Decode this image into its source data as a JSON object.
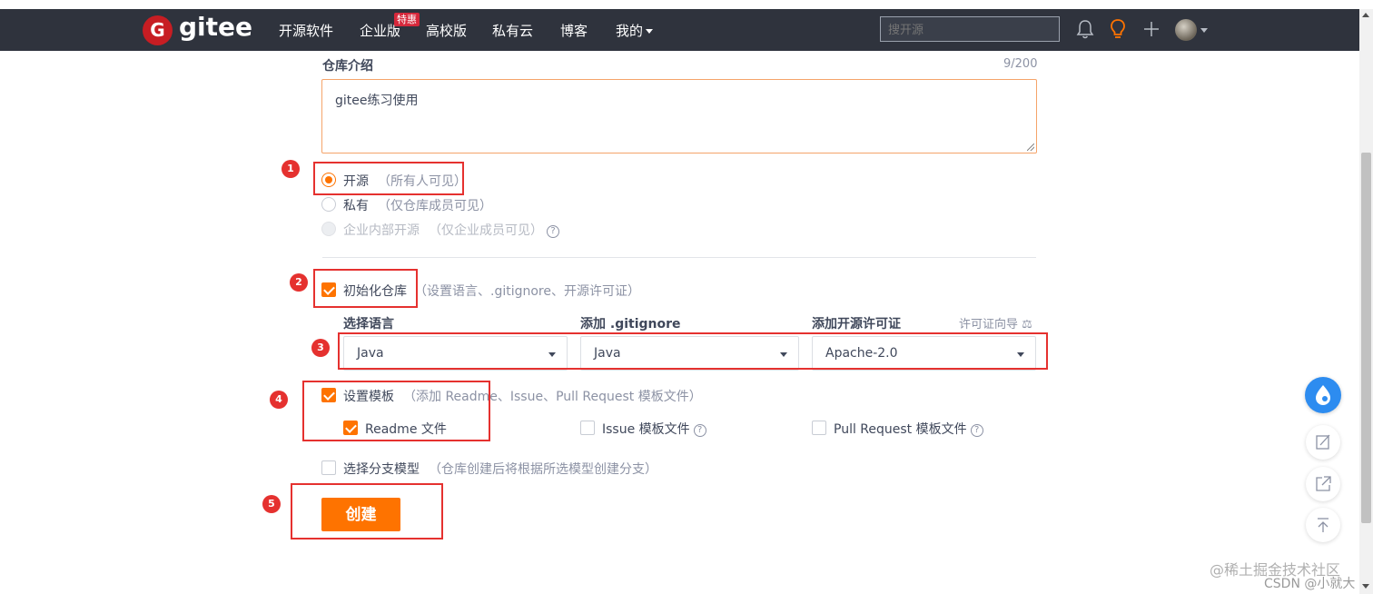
{
  "nav": {
    "logo_letter": "G",
    "logo_text": "gitee",
    "items": [
      "开源软件",
      "企业版",
      "高校版",
      "私有云",
      "博客",
      "我的"
    ],
    "badge": "特惠",
    "search_placeholder": "搜开源"
  },
  "intro": {
    "label": "仓库介绍",
    "counter": "9/200",
    "value": "gitee练习使用"
  },
  "visibility": {
    "options": [
      {
        "label": "开源",
        "hint": "（所有人可见）",
        "selected": true
      },
      {
        "label": "私有",
        "hint": "（仅仓库成员可见）",
        "selected": false
      },
      {
        "label": "企业内部开源",
        "hint": "（仅企业成员可见）",
        "selected": false
      }
    ],
    "help": "?"
  },
  "init": {
    "label": "初始化仓库",
    "hint": "（设置语言、.gitignore、开源许可证）"
  },
  "selects": {
    "language_label": "选择语言",
    "gitignore_label": "添加 .gitignore",
    "license_label": "添加开源许可证",
    "license_guide": "许可证向导",
    "language_value": "Java",
    "gitignore_value": "Java",
    "license_value": "Apache-2.0"
  },
  "template": {
    "label": "设置模板",
    "hint": "（添加 Readme、Issue、Pull Request 模板文件）",
    "readme": "Readme 文件",
    "issue": "Issue 模板文件",
    "pr": "Pull Request 模板文件",
    "help": "?"
  },
  "branch": {
    "label": "选择分支模型",
    "hint": "（仓库创建后将根据所选模型创建分支）"
  },
  "create_label": "创建",
  "markers": [
    "1",
    "2",
    "3",
    "4",
    "5"
  ],
  "watermark": {
    "juejin": "@稀土掘金技术社区",
    "csdn": "CSDN @小就大"
  },
  "colors": {
    "accent": "#fe7300",
    "nav_bg": "#2f333d",
    "annotation_red": "#e5312f"
  }
}
